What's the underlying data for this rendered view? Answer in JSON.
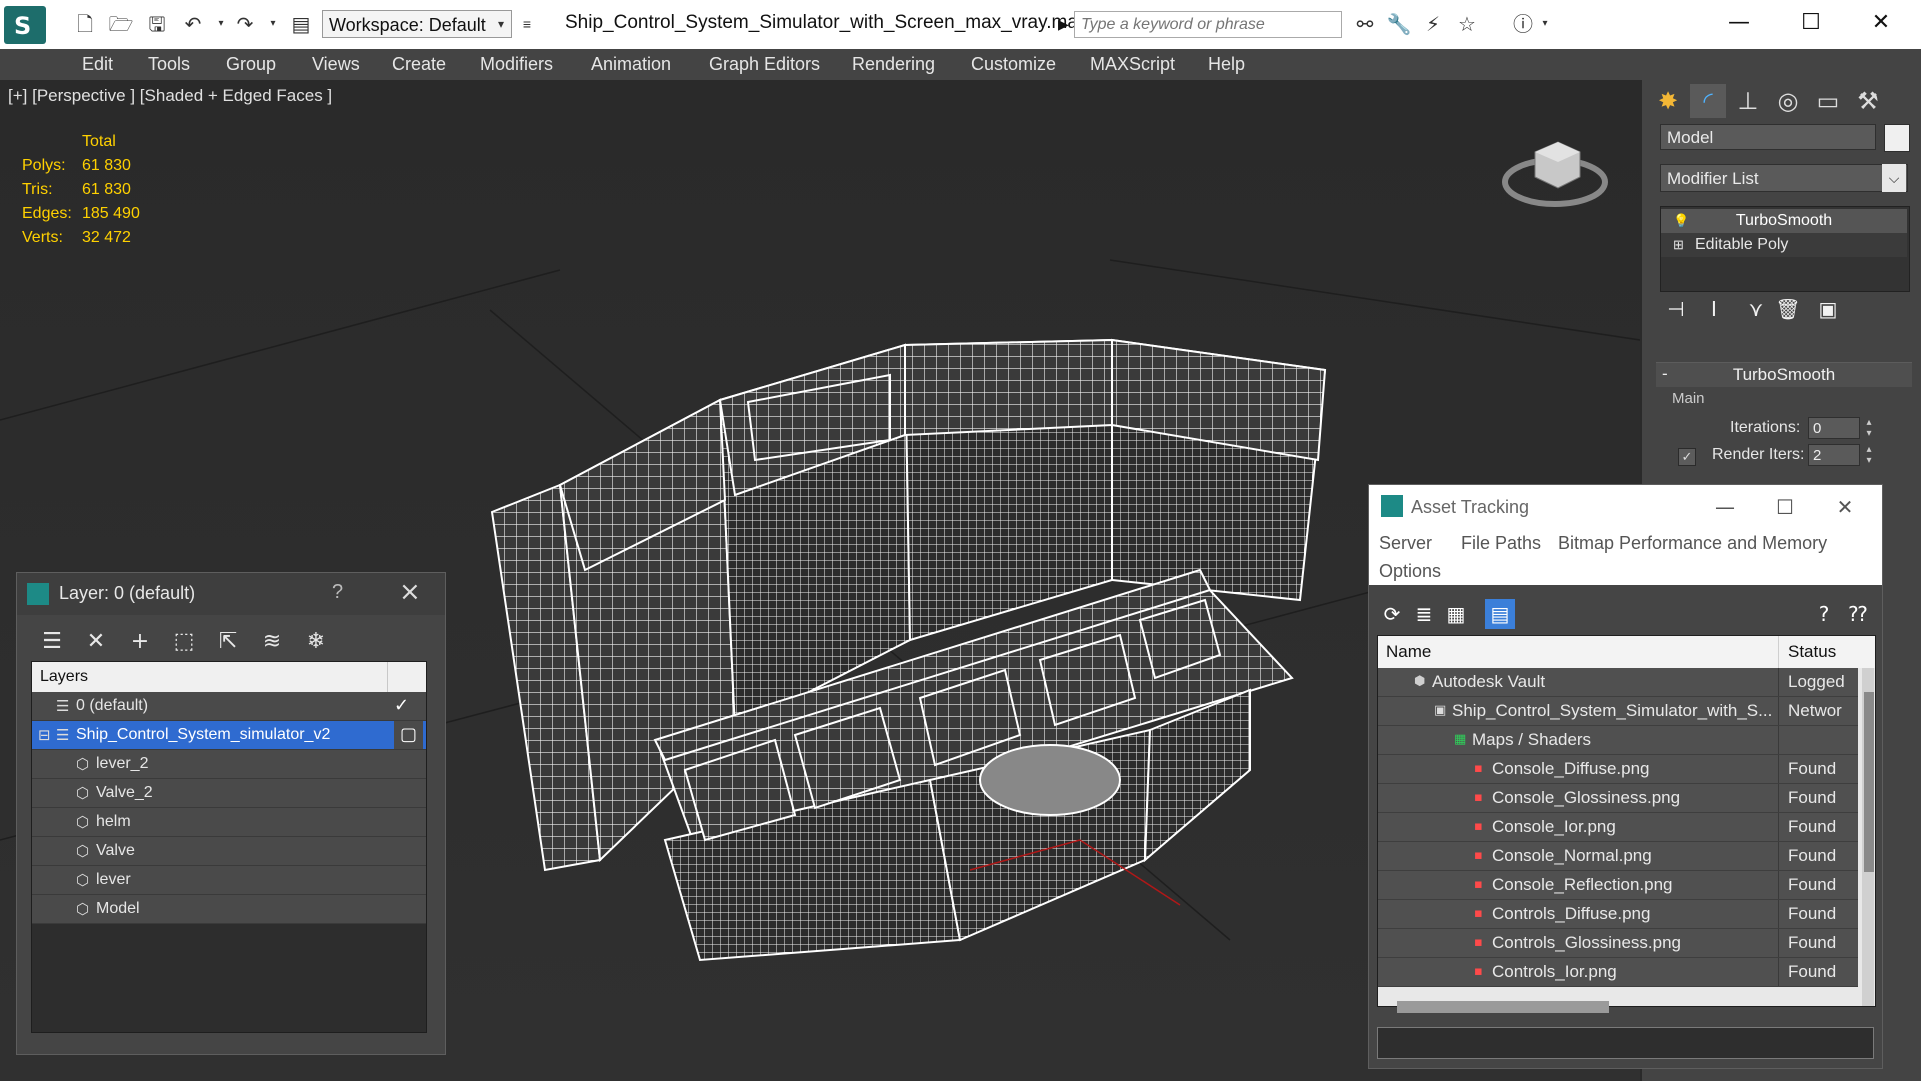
{
  "app": {
    "workspace": "Workspace: Default",
    "document_title": "Ship_Control_System_Simulator_with_Screen_max_vray.max",
    "search_placeholder": "Type a keyword or phrase"
  },
  "menu": [
    "Edit",
    "Tools",
    "Group",
    "Views",
    "Create",
    "Modifiers",
    "Animation",
    "Graph Editors",
    "Rendering",
    "Customize",
    "MAXScript",
    "Help"
  ],
  "viewport": {
    "label": "[+] [Perspective ] [Shaded + Edged Faces ]",
    "stats_header": "Total",
    "stats": [
      {
        "label": "Polys:",
        "value": "61 830"
      },
      {
        "label": "Tris:",
        "value": "61 830"
      },
      {
        "label": "Edges:",
        "value": "185 490"
      },
      {
        "label": "Verts:",
        "value": "32 472"
      }
    ]
  },
  "command_panel": {
    "object_name": "Model",
    "modifier_list": "Modifier List",
    "stack": [
      "TurboSmooth",
      "Editable Poly"
    ],
    "rollout_title": "TurboSmooth",
    "group_main": "Main",
    "iterations_label": "Iterations:",
    "iterations_value": "0",
    "render_iters_label": "Render Iters:",
    "render_iters_value": "2",
    "render_iters_checked": true
  },
  "layer_dialog": {
    "title": "Layer: 0 (default)",
    "help": "?",
    "column_header": "Layers",
    "rows": [
      {
        "name": "0 (default)",
        "indent": 0,
        "type": "layer",
        "checked": true
      },
      {
        "name": "Ship_Control_System_simulator_v2",
        "indent": 0,
        "type": "layer",
        "selected": true
      },
      {
        "name": "lever_2",
        "indent": 1,
        "type": "object"
      },
      {
        "name": "Valve_2",
        "indent": 1,
        "type": "object"
      },
      {
        "name": "helm",
        "indent": 1,
        "type": "object"
      },
      {
        "name": "Valve",
        "indent": 1,
        "type": "object"
      },
      {
        "name": "lever",
        "indent": 1,
        "type": "object"
      },
      {
        "name": "Model",
        "indent": 1,
        "type": "object"
      }
    ]
  },
  "asset_tracking": {
    "title": "Asset Tracking",
    "menu": [
      "Server",
      "File",
      "Paths",
      "Bitmap Performance and Memory",
      "Options"
    ],
    "columns": {
      "name": "Name",
      "status": "Status"
    },
    "rows": [
      {
        "name": "Autodesk Vault",
        "status": "Logged",
        "indent": 0,
        "icon": "vault"
      },
      {
        "name": "Ship_Control_System_Simulator_with_S...",
        "status": "Networ",
        "indent": 1,
        "icon": "max"
      },
      {
        "name": "Maps / Shaders",
        "status": "",
        "indent": 2,
        "icon": "maps"
      },
      {
        "name": "Console_Diffuse.png",
        "status": "Found",
        "indent": 3,
        "icon": "png"
      },
      {
        "name": "Console_Glossiness.png",
        "status": "Found",
        "indent": 3,
        "icon": "png"
      },
      {
        "name": "Console_Ior.png",
        "status": "Found",
        "indent": 3,
        "icon": "png"
      },
      {
        "name": "Console_Normal.png",
        "status": "Found",
        "indent": 3,
        "icon": "png"
      },
      {
        "name": "Console_Reflection.png",
        "status": "Found",
        "indent": 3,
        "icon": "png"
      },
      {
        "name": "Controls_Diffuse.png",
        "status": "Found",
        "indent": 3,
        "icon": "png"
      },
      {
        "name": "Controls_Glossiness.png",
        "status": "Found",
        "indent": 3,
        "icon": "png"
      },
      {
        "name": "Controls_Ior.png",
        "status": "Found",
        "indent": 3,
        "icon": "png"
      }
    ]
  },
  "icons": {
    "png_badge": "PNG",
    "max_badge": "MAX"
  },
  "colors": {
    "selection": "#2f6bd0",
    "stats_yellow": "#ffd100",
    "wire": "#ffffff",
    "panel_accent": "#f3b736"
  }
}
